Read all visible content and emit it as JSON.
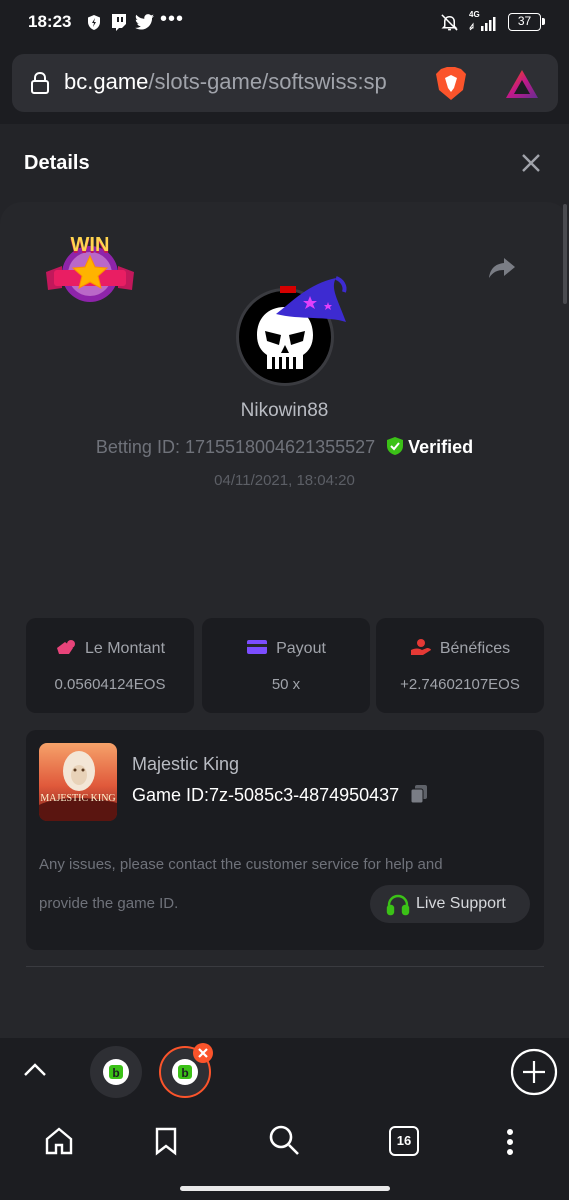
{
  "status_bar": {
    "time": "18:23",
    "network": "4G",
    "battery": "37"
  },
  "url_bar": {
    "domain": "bc.game",
    "path": "/slots-game/softswiss:sp"
  },
  "details": {
    "title": "Details"
  },
  "win_badge": "WIN",
  "player": {
    "name": "Nikowin88",
    "betting_id_label": "Betting ID: 1715518004621355527",
    "verified_label": "Verified",
    "datetime": "04/11/2021, 18:04:20"
  },
  "stats": [
    {
      "label": "Le Montant",
      "value": "0.05604124EOS",
      "icon": "coins-icon",
      "color": "#e8447a"
    },
    {
      "label": "Payout",
      "value": "50 x",
      "icon": "card-icon",
      "color": "#7c4dff"
    },
    {
      "label": "Bénéfices",
      "value": "+2.74602107EOS",
      "icon": "profit-hand-icon",
      "color": "#e53935"
    }
  ],
  "game": {
    "name": "Majestic King",
    "game_id_label": "Game ID:",
    "game_id": "7z-5085c3-4874950437",
    "thumbnail_title": "MAJESTIC KING"
  },
  "support": {
    "message_line1": "Any issues, please contact the customer service for help and",
    "message_line2": "provide the game ID.",
    "button_label": "Live Support"
  },
  "browser_nav": {
    "tab_count": "16"
  },
  "colors": {
    "background": "#1c1d21",
    "card": "#26272b",
    "panel": "#1b1c20",
    "accent_green": "#3bc117",
    "muted_text": "#a0a3aa"
  }
}
